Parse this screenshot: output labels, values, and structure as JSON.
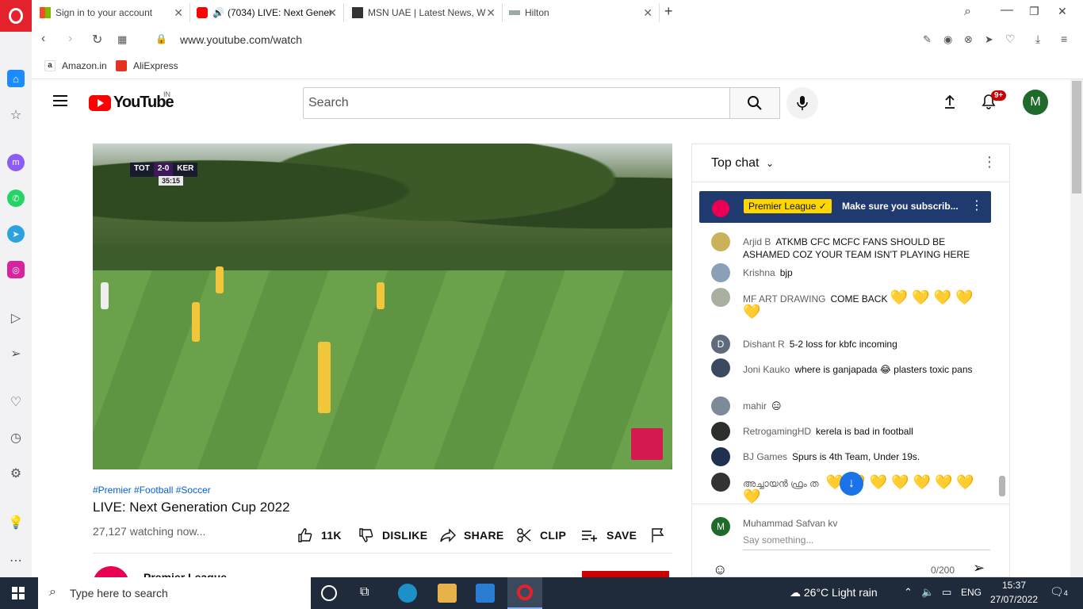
{
  "browser": {
    "tabs": [
      {
        "label": "Sign in to your account",
        "active": false
      },
      {
        "label": "(7034) LIVE: Next Gener",
        "active": true
      },
      {
        "label": "MSN UAE | Latest News, W",
        "active": false
      },
      {
        "label": "Hilton",
        "active": false
      }
    ],
    "new_tab": "+",
    "url": "www.youtube.com/watch",
    "bookmarks": [
      "Amazon.in",
      "AliExpress"
    ]
  },
  "youtube": {
    "logo_text": "YouTube",
    "country": "IN",
    "search_placeholder": "Search",
    "notification_count": "9+",
    "avatar_letter": "M"
  },
  "video": {
    "scorebug": {
      "home": "TOT",
      "score": "2-0",
      "away": "KER",
      "time": "35:15"
    },
    "hashtags": "#Premier #Football #Soccer",
    "title": "LIVE: Next Generation Cup 2022",
    "watching": "27,127 watching now...",
    "actions": {
      "likes": "11K",
      "dislike": "DISLIKE",
      "share": "SHARE",
      "clip": "CLIP",
      "save": "SAVE"
    },
    "channel_name": "Premier League"
  },
  "chat": {
    "header": "Top chat",
    "pinned": {
      "author": "Premier League",
      "message": "Make sure you subscrib..."
    },
    "messages": [
      {
        "author": "Arjid B",
        "text": "ATKMB CFC MCFC FANS SHOULD BE ASHAMED COZ YOUR TEAM ISN'T PLAYING HERE",
        "color": "#c9b25a"
      },
      {
        "author": "Krishna",
        "text": "bjp",
        "color": "#8aa0b8"
      },
      {
        "author": "MF ART DRAWING",
        "text": "COME BACK",
        "hearts": "💛 💛 💛 💛 💛",
        "color": "#a9b0a0"
      },
      {
        "author": "Dishant R",
        "text": "5-2 loss for kbfc incoming",
        "color": "#5f6b7a",
        "initial": "D"
      },
      {
        "author": "Joni Kauko",
        "text": "where is ganjapada 😂 plasters toxic pans",
        "color": "#3c4a60"
      },
      {
        "author": "mahir",
        "text": "😑",
        "color": "#7d8b99"
      },
      {
        "author": "RetrogamingHD",
        "text": "kerela is bad in football",
        "color": "#2a2f2a"
      },
      {
        "author": "BJ Games",
        "text": "Spurs is 4th Team, Under 19s.",
        "color": "#1f3050"
      },
      {
        "author": "അച്ചായൻ ഫ്രം ത",
        "text": "💛 💛 💛 💛 💛 💛 💛 💛",
        "color": "#333333"
      }
    ],
    "input": {
      "author": "Muhammad Safvan kv",
      "placeholder": "Say something...",
      "count": "0/200",
      "avatar_letter": "M"
    }
  },
  "taskbar": {
    "search_placeholder": "Type here to search",
    "weather": "26°C  Light rain",
    "language": "ENG",
    "time": "15:37",
    "date": "27/07/2022",
    "notifications": "4"
  },
  "colors": {
    "yt_red": "#ff0000",
    "link_blue": "#065fd4",
    "pinned_bg": "#1f3a6e",
    "taskbar": "#1f2b3a"
  }
}
